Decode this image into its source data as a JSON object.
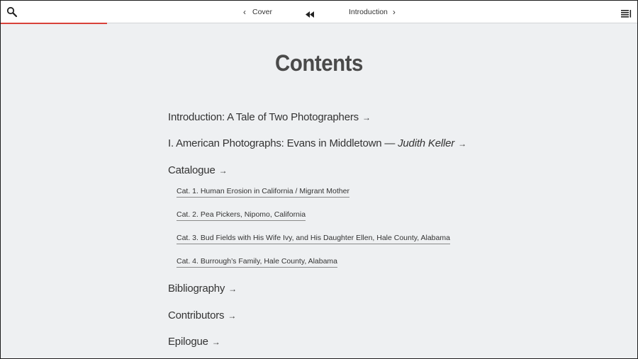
{
  "navbar": {
    "prev_label": "Cover",
    "next_label": "Introduction",
    "icons": {
      "search": "search-icon",
      "prev": "chevron-left-icon",
      "rewind": "rewind-icon",
      "next": "chevron-right-icon",
      "menu": "menu-icon"
    }
  },
  "page": {
    "title": "Contents"
  },
  "toc": {
    "intro": {
      "label": "Introduction: A Tale of Two Photographers",
      "arrow": "→"
    },
    "part1": {
      "label": "I. American Photographs: Evans in Middletown — ",
      "author": "Judith Keller",
      "arrow": "→"
    },
    "catalogue": {
      "label": "Catalogue",
      "arrow": "→"
    },
    "catalogue_items": [
      "Cat. 1. Human Erosion in California / Migrant Mother",
      "Cat. 2. Pea Pickers, Nipomo, California",
      "Cat. 3. Bud Fields with His Wife Ivy, and His Daughter Ellen, Hale County, Alabama",
      "Cat. 4. Burrough’s Family, Hale County, Alabama"
    ],
    "bibliography": {
      "label": "Bibliography",
      "arrow": "→"
    },
    "contributors": {
      "label": "Contributors",
      "arrow": "→"
    },
    "epilogue": {
      "label": "Epilogue",
      "arrow": "→"
    }
  },
  "colors": {
    "accent_progress": "#d8413a",
    "background": "#eef0f2",
    "navbar_bg": "#ffffff",
    "text": "#333333"
  }
}
